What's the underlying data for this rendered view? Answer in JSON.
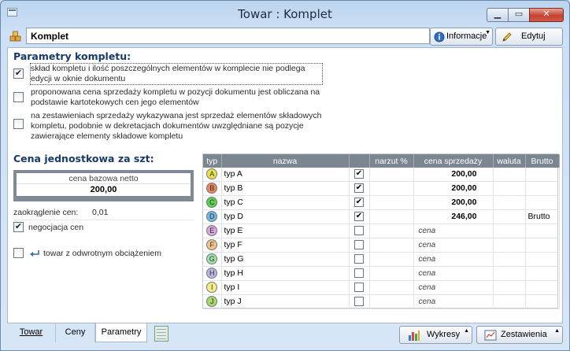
{
  "window": {
    "title": "Towar : Komplet",
    "minimize_glyph": "▁",
    "maximize_glyph": "▭",
    "close_glyph": "✕"
  },
  "toolbar": {
    "name_value": "Komplet",
    "info_label": "Informacje",
    "edit_label": "Edytuj"
  },
  "params": {
    "title": "Parametry kompletu:",
    "options": [
      {
        "checked": true,
        "text": "skład kompletu i ilość poszczególnych elementów w komplecie nie podlega edycji w oknie dokumentu"
      },
      {
        "checked": false,
        "text": "proponowana cena sprzedaży kompletu w pozycji dokumentu jest obliczana na podstawie kartotekowych cen jego elementów"
      },
      {
        "checked": false,
        "text": "na zestawieniach sprzedaży wykazywana jest sprzedaż elementów składowych kompletu, podobnie w dekretacjach dokumentów uwzględniane są pozycje zawierające elementy składowe kompletu"
      }
    ]
  },
  "price": {
    "title": "Cena jednostkowa za szt:",
    "base_label": "cena bazowa netto",
    "base_value": "200,00",
    "rounding_label": "zaokrąglenie cen:",
    "rounding_value": "0,01",
    "negotiation_label": "negocjacja cen",
    "negotiation_checked": true,
    "reverse_label": "towar z odwrotnym obciążeniem",
    "reverse_checked": false
  },
  "grid": {
    "headers": [
      "typ",
      "nazwa",
      "",
      "narzut %",
      "cena sprzedaży",
      "waluta",
      "Brutto"
    ],
    "rows": [
      {
        "letter": "A",
        "color": "#e9e24a",
        "name": "typ A",
        "checked": true,
        "markup": "",
        "price": "200,00",
        "currency": "",
        "gross": ""
      },
      {
        "letter": "B",
        "color": "#e7855f",
        "name": "typ B",
        "checked": true,
        "markup": "",
        "price": "200,00",
        "currency": "",
        "gross": ""
      },
      {
        "letter": "C",
        "color": "#5fcf4f",
        "name": "typ C",
        "checked": true,
        "markup": "",
        "price": "200,00",
        "currency": "",
        "gross": ""
      },
      {
        "letter": "D",
        "color": "#73b7e3",
        "name": "typ D",
        "checked": true,
        "markup": "",
        "price": "246,00",
        "currency": "",
        "gross": "Brutto"
      },
      {
        "letter": "E",
        "color": "#d7a6df",
        "name": "typ E",
        "checked": false,
        "markup": "",
        "price": "cena",
        "currency": "",
        "gross": ""
      },
      {
        "letter": "F",
        "color": "#f2c08f",
        "name": "typ F",
        "checked": false,
        "markup": "",
        "price": "cena",
        "currency": "",
        "gross": ""
      },
      {
        "letter": "G",
        "color": "#9fe3a8",
        "name": "typ G",
        "checked": false,
        "markup": "",
        "price": "cena",
        "currency": "",
        "gross": ""
      },
      {
        "letter": "H",
        "color": "#b7b7e6",
        "name": "typ H",
        "checked": false,
        "markup": "",
        "price": "cena",
        "currency": "",
        "gross": ""
      },
      {
        "letter": "I",
        "color": "#f3ec88",
        "name": "typ I",
        "checked": false,
        "markup": "",
        "price": "cena",
        "currency": "",
        "gross": ""
      },
      {
        "letter": "J",
        "color": "#a6d96b",
        "name": "typ J",
        "checked": false,
        "markup": "",
        "price": "cena",
        "currency": "",
        "gross": ""
      }
    ]
  },
  "bottom": {
    "tabs": [
      "Towar",
      "Ceny",
      "Parametry"
    ],
    "active_tab": "Parametry",
    "charts_label": "Wykresy",
    "reports_label": "Zestawienia"
  }
}
